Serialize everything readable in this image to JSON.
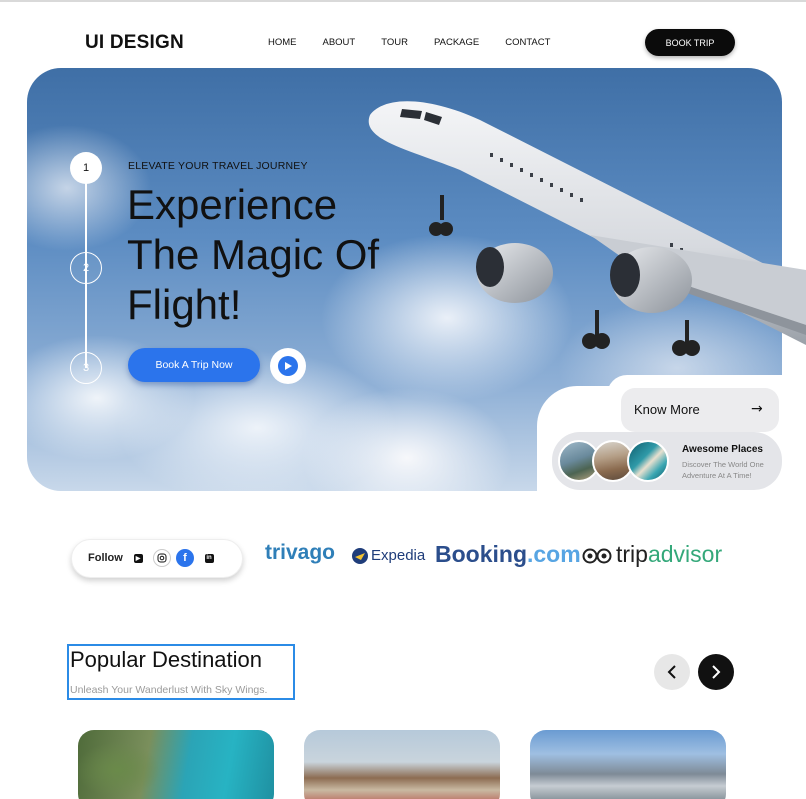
{
  "header": {
    "logo": "UI DESIGN",
    "nav": [
      "HOME",
      "ABOUT",
      "TOUR",
      "PACKAGE",
      "CONTACT"
    ],
    "cta": "BOOK TRIP"
  },
  "hero": {
    "steps": [
      "1",
      "2",
      "3"
    ],
    "eyebrow": "ELEVATE YOUR TRAVEL JOURNEY",
    "headline_lines": [
      "Experience",
      "The Magic Of",
      "Flight!"
    ],
    "cta": "Book A Trip Now",
    "know_more": "Know More",
    "places_title": "Awesome Places",
    "places_sub": "Discover The World One Adventure At A Time!"
  },
  "follow": {
    "label": "Follow",
    "icons": [
      "youtube-icon",
      "instagram-icon",
      "facebook-icon",
      "linkedin-icon"
    ]
  },
  "brands": {
    "trivago": "trivago",
    "expedia": "Expedia",
    "booking": "Booking",
    "booking_suffix": ".com",
    "trip": "trip",
    "advisor": "advisor"
  },
  "popular": {
    "title": "Popular Destination",
    "subtitle": "Unleash Your Wanderlust With Sky Wings."
  },
  "colors": {
    "accent": "#2b74ec",
    "dark": "#0b0b0b",
    "selection": "#2b8be6"
  }
}
